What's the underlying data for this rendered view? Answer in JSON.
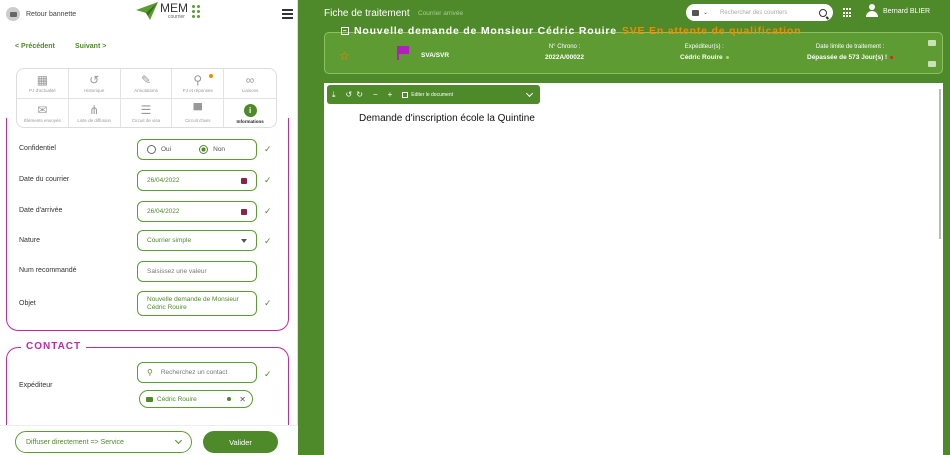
{
  "header": {
    "back_label": "Retour bannette",
    "logo_text": "MEM",
    "logo_sub": "courrier"
  },
  "nav": {
    "prev": "< Précédent",
    "next": "Suivant >"
  },
  "tabs": [
    {
      "label": "PJ d'actualité",
      "icon": "grid-icon"
    },
    {
      "label": "Historique",
      "icon": "history-icon"
    },
    {
      "label": "Annotations",
      "icon": "pen-icon"
    },
    {
      "label": "PJ et réponses",
      "icon": "paperclip-icon"
    },
    {
      "label": "Liaisons",
      "icon": "link-icon"
    },
    {
      "label": "Éléments envoyés",
      "icon": "mail-icon"
    },
    {
      "label": "Liste de diffusion",
      "icon": "share-icon"
    },
    {
      "label": "Circuit de visa",
      "icon": "list-icon"
    },
    {
      "label": "Circuit d'avis",
      "icon": "comment-icon"
    },
    {
      "label": "Informations",
      "icon": "info-icon"
    }
  ],
  "form": {
    "confidential_label": "Confidentiel",
    "radio_yes": "Oui",
    "radio_no": "Non",
    "courrier_date_label": "Date du courrier",
    "courrier_date": "26/04/2022",
    "arrival_date_label": "Date d'arrivée",
    "arrival_date": "26/04/2022",
    "nature_label": "Nature",
    "nature_value": "Courrier simple",
    "num_label": "Num recommandé",
    "num_placeholder": "Saisissez une valeur",
    "object_label": "Objet",
    "object_value": "Nouvelle demande de Monsieur Cédric Rouire"
  },
  "contact": {
    "title": "CONTACT",
    "sender_label": "Expéditeur",
    "search_placeholder": "Recherchez un contact",
    "chip": "Cédric Rouire"
  },
  "bottom": {
    "diffuser": "Diffuser directement => Service",
    "valider": "Valider"
  },
  "right": {
    "title": "Fiche de traitement",
    "subtitle": "Courrier arrivée",
    "search_placeholder": "Rechercher des courriers",
    "user": "Bernard BLIER",
    "doc_title": "Nouvelle demande de Monsieur Cédric Rouire",
    "status": "SVE En attente de qualification",
    "sva": "SVA/SVR",
    "chrono_label": "N° Chrono :",
    "chrono": "2022A/00022",
    "sender_label": "Expéditeur(s) :",
    "sender": "Cédric Rouire",
    "deadline_label": "Date limite de traitement :",
    "deadline": "Dépassée de 573 Jour(s) !",
    "edit_doc": "Editer le document",
    "doc_content": "Demande d'inscription école la Quintine"
  },
  "colors": {
    "primary": "#4f8a2a",
    "accent": "#c02aa6",
    "warning": "#f18a00"
  }
}
